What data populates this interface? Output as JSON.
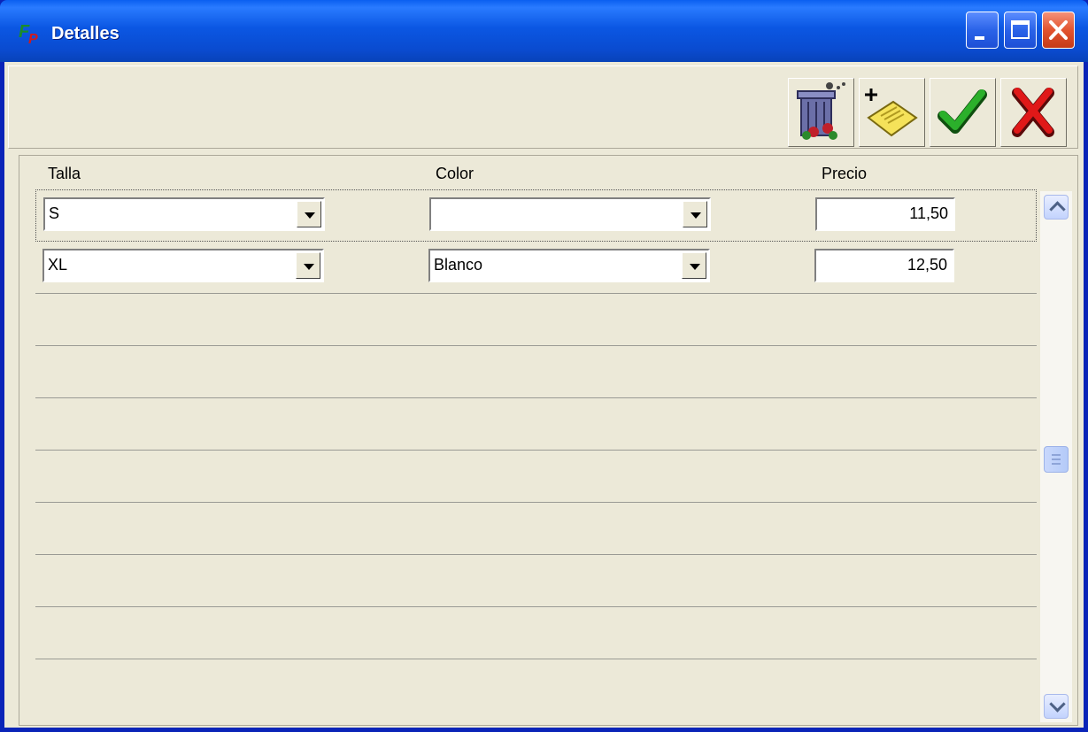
{
  "window": {
    "title": "Detalles",
    "icon": "fp-app-icon",
    "controls": [
      "minimize-icon",
      "maximize-icon",
      "close-icon"
    ]
  },
  "toolbar": {
    "buttons": [
      {
        "icon": "delete-trash-icon"
      },
      {
        "icon": "new-record-icon"
      },
      {
        "icon": "accept-check-icon"
      },
      {
        "icon": "cancel-x-icon"
      }
    ]
  },
  "grid": {
    "columns": [
      "Talla",
      "Color",
      "Precio"
    ],
    "rows": [
      {
        "talla": "S",
        "color": "",
        "precio": "11,50"
      },
      {
        "talla": "XL",
        "color": "Blanco",
        "precio": "12,50"
      }
    ],
    "empty_rows": 8
  },
  "colors": {
    "titlebar": "#0A4BD0",
    "background": "#ECE9D8",
    "close_button": "#E2532F",
    "check_green": "#1E8C1E",
    "cancel_red": "#D01010"
  }
}
